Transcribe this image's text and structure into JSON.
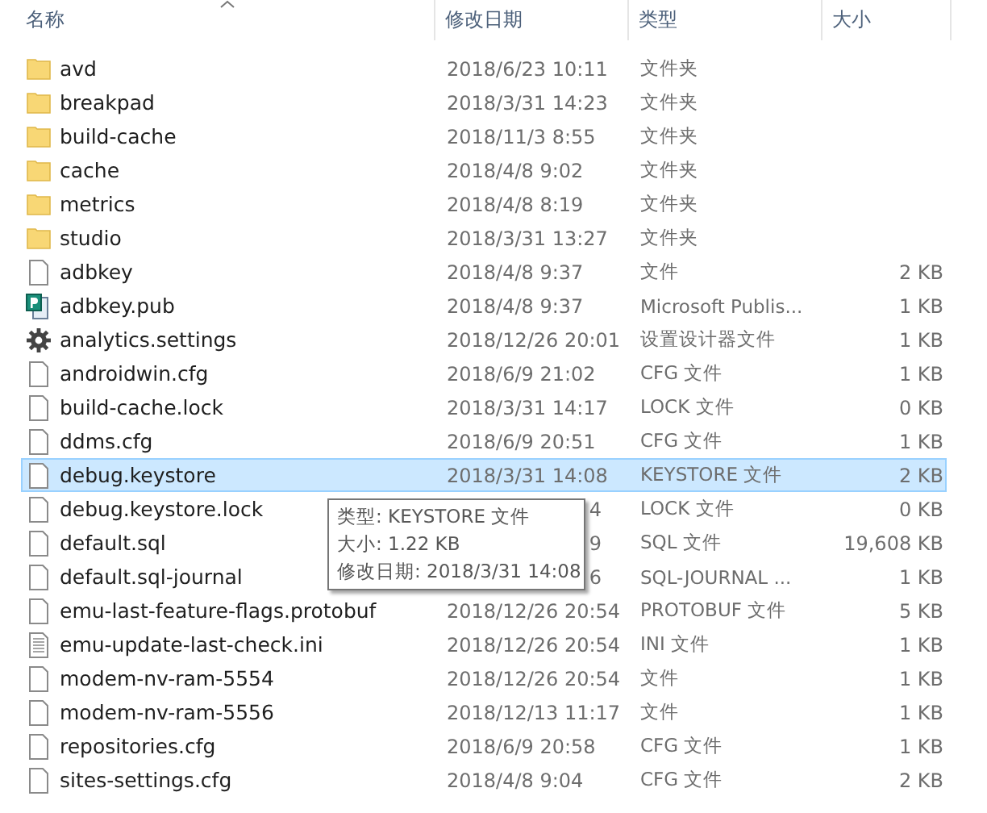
{
  "columns": [
    {
      "label": "名称",
      "sorted": true
    },
    {
      "label": "修改日期",
      "sorted": false
    },
    {
      "label": "类型",
      "sorted": false
    },
    {
      "label": "大小",
      "sorted": false
    }
  ],
  "rows": [
    {
      "kind": "folder",
      "name": "avd",
      "date": "2018/6/23 10:11",
      "type": "文件夹",
      "selected": false
    },
    {
      "kind": "folder",
      "name": "breakpad",
      "date": "2018/3/31 14:23",
      "type": "文件夹",
      "selected": false
    },
    {
      "kind": "folder",
      "name": "build-cache",
      "date": "2018/11/3 8:55",
      "type": "文件夹",
      "selected": false
    },
    {
      "kind": "folder",
      "name": "cache",
      "date": "2018/4/8 9:02",
      "type": "文件夹",
      "selected": false
    },
    {
      "kind": "folder",
      "name": "metrics",
      "date": "2018/4/8 8:19",
      "type": "文件夹",
      "selected": false
    },
    {
      "kind": "folder",
      "name": "studio",
      "date": "2018/3/31 13:27",
      "type": "文件夹",
      "selected": false
    },
    {
      "kind": "file",
      "name": "adbkey",
      "date": "2018/4/8 9:37",
      "type": "文件",
      "size": "2 KB",
      "selected": false
    },
    {
      "kind": "publisher",
      "name": "adbkey.pub",
      "date": "2018/4/8 9:37",
      "type": "Microsoft Publis...",
      "size": "1 KB",
      "selected": false
    },
    {
      "kind": "settings",
      "name": "analytics.settings",
      "date": "2018/12/26 20:01",
      "type": "设置设计器文件",
      "size": "1 KB",
      "selected": false
    },
    {
      "kind": "file",
      "name": "androidwin.cfg",
      "date": "2018/6/9 21:02",
      "type": "CFG 文件",
      "size": "1 KB",
      "selected": false
    },
    {
      "kind": "file",
      "name": "build-cache.lock",
      "date": "2018/3/31 14:17",
      "type": "LOCK 文件",
      "size": "0 KB",
      "selected": false
    },
    {
      "kind": "file",
      "name": "ddms.cfg",
      "date": "2018/6/9 20:51",
      "type": "CFG 文件",
      "size": "1 KB",
      "selected": false
    },
    {
      "kind": "file",
      "name": "debug.keystore",
      "date": "2018/3/31 14:08",
      "type": "KEYSTORE 文件",
      "size": "2 KB",
      "selected": true
    },
    {
      "kind": "file",
      "name": "debug.keystore.lock",
      "date": "4",
      "date_covered": true,
      "type": "LOCK 文件",
      "size": "0 KB",
      "selected": false
    },
    {
      "kind": "file",
      "name": "default.sql",
      "date": "9",
      "date_covered": true,
      "type": "SQL 文件",
      "size": "19,608 KB",
      "selected": false
    },
    {
      "kind": "file",
      "name": "default.sql-journal",
      "date": "6",
      "date_covered": true,
      "type": "SQL-JOURNAL ...",
      "size": "1 KB",
      "selected": false
    },
    {
      "kind": "file",
      "name": "emu-last-feature-flags.protobuf",
      "date": "2018/12/26 20:54",
      "type": "PROTOBUF 文件",
      "size": "5 KB",
      "selected": false
    },
    {
      "kind": "text",
      "name": "emu-update-last-check.ini",
      "date": "2018/12/26 20:54",
      "type": "INI 文件",
      "size": "1 KB",
      "selected": false
    },
    {
      "kind": "file",
      "name": "modem-nv-ram-5554",
      "date": "2018/12/26 20:54",
      "type": "文件",
      "size": "1 KB",
      "selected": false
    },
    {
      "kind": "file",
      "name": "modem-nv-ram-5556",
      "date": "2018/12/13 11:17",
      "type": "文件",
      "size": "1 KB",
      "selected": false
    },
    {
      "kind": "file",
      "name": "repositories.cfg",
      "date": "2018/6/9 20:58",
      "type": "CFG 文件",
      "size": "1 KB",
      "selected": false
    },
    {
      "kind": "file",
      "name": "sites-settings.cfg",
      "date": "2018/4/8 9:04",
      "type": "CFG 文件",
      "size": "2 KB",
      "selected": false
    }
  ],
  "tooltip": {
    "lines": [
      "类型: KEYSTORE 文件",
      "大小: 1.22 KB",
      "修改日期: 2018/3/31 14:08"
    ]
  }
}
